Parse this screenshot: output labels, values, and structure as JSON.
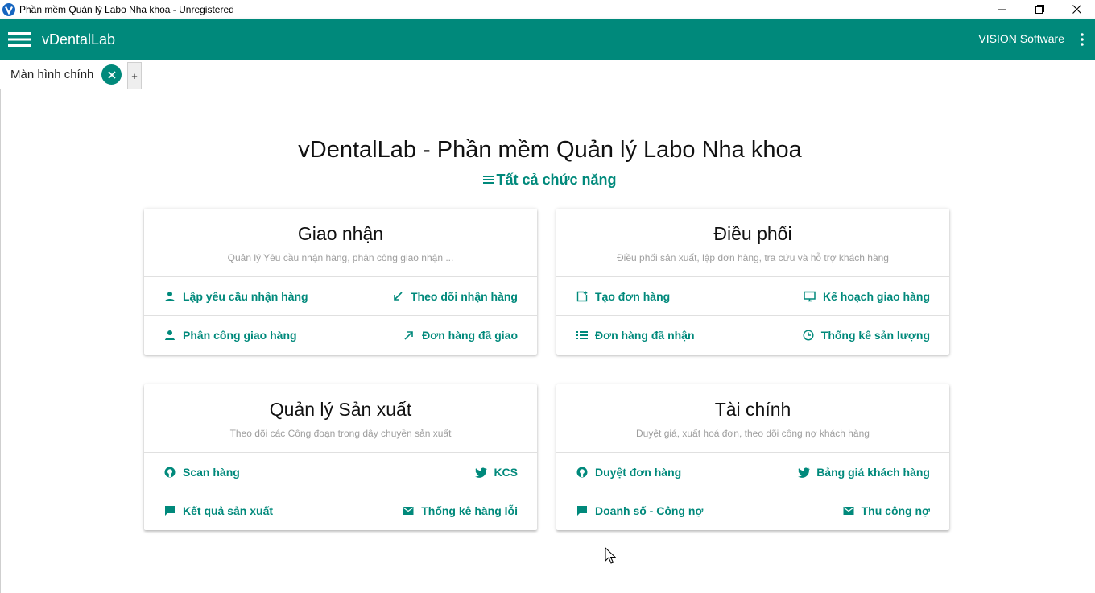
{
  "window": {
    "title": "Phần mềm Quản lý Labo Nha khoa - Unregistered",
    "icon": "v-logo-icon",
    "controls": [
      "minimize-icon",
      "restore-icon",
      "close-icon"
    ]
  },
  "appbar": {
    "brand": "vDentalLab",
    "company": "VISION Software",
    "color": "#00897b"
  },
  "tabs": [
    {
      "label": "Màn hình chính"
    }
  ],
  "tab_add_label": "+",
  "main": {
    "title": "vDentalLab - Phần mềm Quản lý Labo Nha khoa",
    "all_functions": "Tất cả chức năng"
  },
  "cards": [
    {
      "title": "Giao nhận",
      "subtitle": "Quản lý Yêu cầu nhận hàng, phân công giao nhận ...",
      "rows": [
        {
          "left": {
            "label": "Lập yêu cầu nhận hàng",
            "icon": "person-icon"
          },
          "right": {
            "label": "Theo dõi nhận hàng",
            "icon": "arrow-down-left-icon"
          }
        },
        {
          "left": {
            "label": "Phân công giao hàng",
            "icon": "person-icon"
          },
          "right": {
            "label": "Đơn hàng đã giao",
            "icon": "arrow-up-right-icon"
          }
        }
      ]
    },
    {
      "title": "Điều phối",
      "subtitle": "Điều phối sản xuất, lập đơn hàng, tra cứu và hỗ trợ khách hàng",
      "rows": [
        {
          "left": {
            "label": "Tạo đơn hàng",
            "icon": "add-box-icon"
          },
          "right": {
            "label": "Kế hoạch giao hàng",
            "icon": "monitor-icon"
          }
        },
        {
          "left": {
            "label": "Đơn hàng đã nhận",
            "icon": "list-icon"
          },
          "right": {
            "label": "Thống kê sản lượng",
            "icon": "clock-icon"
          }
        }
      ]
    },
    {
      "title": "Quản lý Sản xuất",
      "subtitle": "Theo dõi các Công đoạn trong dây chuyền sản xuất",
      "rows": [
        {
          "left": {
            "label": "Scan hàng",
            "icon": "github-icon"
          },
          "right": {
            "label": "KCS",
            "icon": "twitter-icon"
          }
        },
        {
          "left": {
            "label": "Kết quả sản xuất",
            "icon": "chat-icon"
          },
          "right": {
            "label": "Thống kê hàng lỗi",
            "icon": "mail-icon"
          }
        }
      ]
    },
    {
      "title": "Tài chính",
      "subtitle": "Duyệt giá, xuất hoá đơn, theo dõi công nợ khách hàng",
      "rows": [
        {
          "left": {
            "label": "Duyệt đơn hàng",
            "icon": "github-icon"
          },
          "right": {
            "label": "Bảng giá khách hàng",
            "icon": "twitter-icon"
          }
        },
        {
          "left": {
            "label": "Doanh số - Công nợ",
            "icon": "chat-icon"
          },
          "right": {
            "label": "Thu công nợ",
            "icon": "mail-icon"
          }
        }
      ]
    }
  ]
}
